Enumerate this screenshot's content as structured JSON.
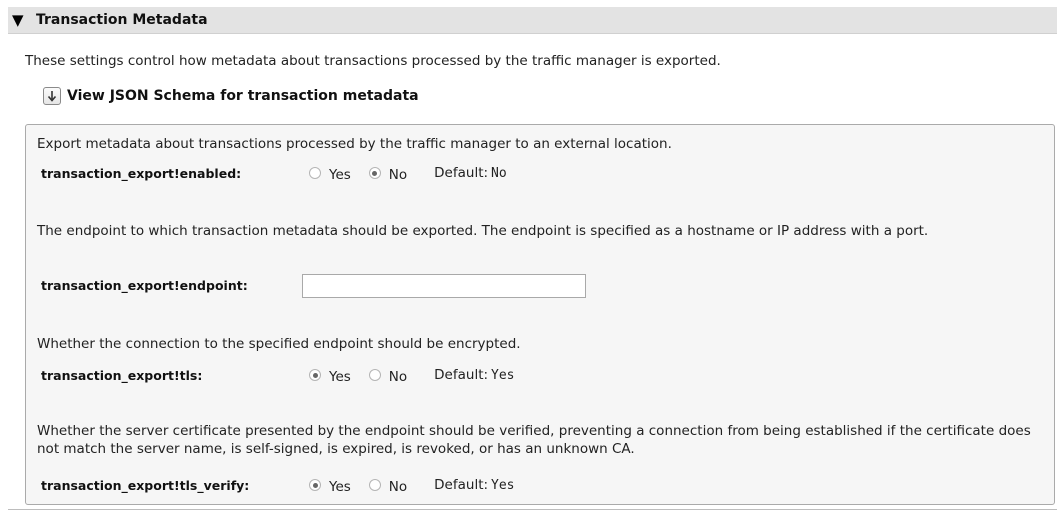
{
  "section": {
    "collapse_icon": "▼",
    "title": "Transaction Metadata",
    "intro": "These settings control how metadata about transactions processed by the traffic manager is exported."
  },
  "schema_link": {
    "icon": "download-arrow-icon",
    "label": "View JSON Schema for transaction metadata"
  },
  "settings": {
    "enabled": {
      "description": "Export metadata about transactions processed by the traffic manager to an external location.",
      "key": "transaction_export!enabled:",
      "yes_label": "Yes",
      "no_label": "No",
      "selected": "No",
      "default_label": "Default:",
      "default_value": "No"
    },
    "endpoint": {
      "description": "The endpoint to which transaction metadata should be exported. The endpoint is specified as a hostname or IP address with a port.",
      "key": "transaction_export!endpoint:",
      "value": ""
    },
    "tls": {
      "description": "Whether the connection to the specified endpoint should be encrypted.",
      "key": "transaction_export!tls:",
      "yes_label": "Yes",
      "no_label": "No",
      "selected": "Yes",
      "default_label": "Default:",
      "default_value": "Yes"
    },
    "tls_verify": {
      "description": "Whether the server certificate presented by the endpoint should be verified, preventing a connection from being established if the certificate does not match the server name, is self-signed, is expired, is revoked, or has an unknown CA.",
      "key": "transaction_export!tls_verify:",
      "yes_label": "Yes",
      "no_label": "No",
      "selected": "Yes",
      "default_label": "Default:",
      "default_value": "Yes"
    }
  }
}
